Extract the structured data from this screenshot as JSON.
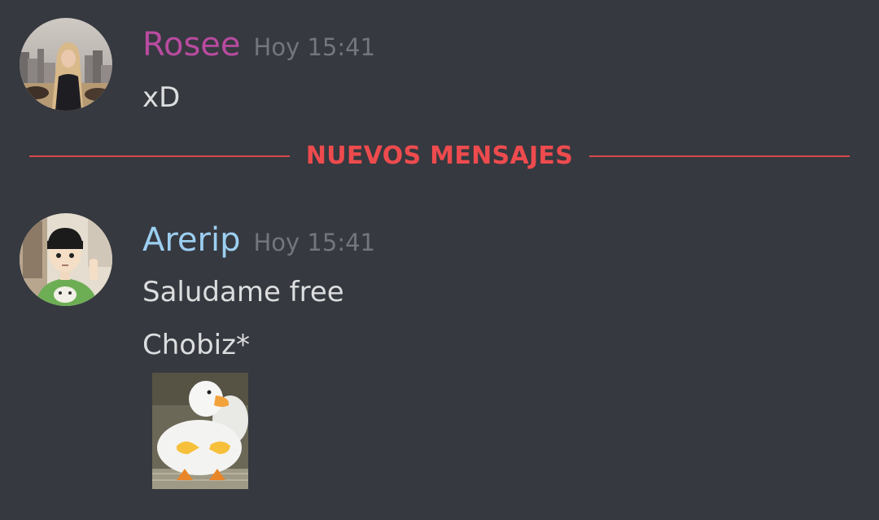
{
  "colors": {
    "background": "#36393f",
    "new_messages_accent": "#ee4b4e",
    "rosee_name": "#b94ba0",
    "arerip_name": "#9ccff1",
    "timestamp": "#72767d",
    "message_text": "#dcddde"
  },
  "messages": [
    {
      "author": "Rosee",
      "timestamp": "Hoy 15:41",
      "avatar_icon": "user-avatar-photo-icon",
      "lines": [
        "xD"
      ]
    },
    {
      "author": "Arerip",
      "timestamp": "Hoy 15:41",
      "avatar_icon": "anime-character-avatar-icon",
      "lines": [
        "Saludame free",
        "Chobiz*"
      ],
      "attachment_icon": "duck-pointing-image-icon"
    }
  ],
  "divider": {
    "label": "NUEVOS MENSAJES"
  }
}
